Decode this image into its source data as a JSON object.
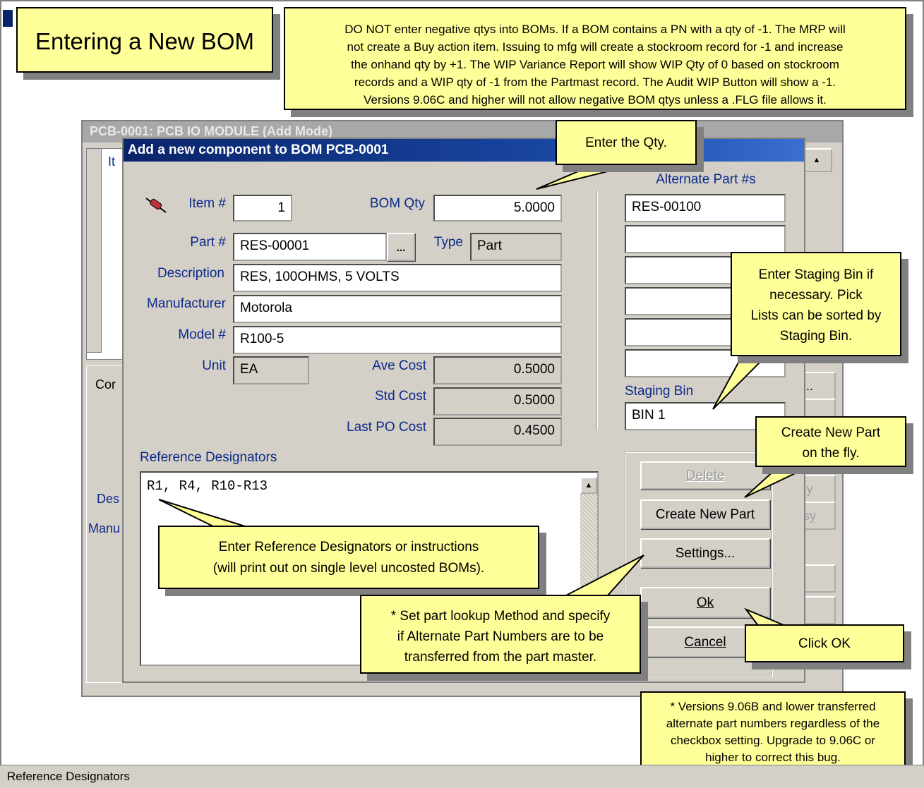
{
  "status_bar": {
    "text": "Reference Designators"
  },
  "background_window": {
    "title": "PCB-0001: PCB IO MODULE     (Add Mode)",
    "grid_col_label": "It",
    "left_labels": [
      "Cor",
      "Des",
      "Manu"
    ],
    "right_buttons": [
      "..",
      "y",
      "sy"
    ]
  },
  "dialog": {
    "title": "Add a new component to BOM PCB-0001",
    "item_label": "Item #",
    "item_value": "1",
    "bomqty_label": "BOM Qty",
    "bomqty_value": "5.0000",
    "part_label": "Part #",
    "part_value": "RES-00001",
    "part_lookup_label": "...",
    "type_label": "Type",
    "type_value": "Part",
    "description_label": "Description",
    "description_value": "RES, 100OHMS, 5 VOLTS",
    "manufacturer_label": "Manufacturer",
    "manufacturer_value": "Motorola",
    "model_label": "Model #",
    "model_value": "R100-5",
    "unit_label": "Unit",
    "unit_value": "EA",
    "avecost_label": "Ave Cost",
    "avecost_value": "0.5000",
    "stdcost_label": "Std Cost",
    "stdcost_value": "0.5000",
    "lastpo_label": "Last PO Cost",
    "lastpo_value": "0.4500",
    "alt_parts_label": "Alternate Part #s",
    "alt_parts": [
      "RES-00100",
      "",
      "",
      "",
      "",
      ""
    ],
    "staging_label": "Staging Bin",
    "staging_value": "BIN 1",
    "ref_label": "Reference Designators",
    "ref_value": "R1, R4, R10-R13",
    "buttons": {
      "delete": "Delete",
      "create": "Create New Part",
      "settings": "Settings...",
      "ok": "Ok",
      "cancel": "Cancel"
    }
  },
  "callouts": {
    "title": "Entering a New BOM",
    "warning": [
      "DO NOT enter negative qtys into BOMs.  If a BOM contains a PN with a qty of -1.  The MRP will",
      "not create a Buy action item.  Issuing to mfg will create a stockroom record for -1 and increase",
      "the onhand qty by +1. The WIP Variance Report will show WIP Qty of 0 based on stockroom",
      "records and a WIP qty of -1 from the Partmast record. The Audit WIP Button will show a -1.",
      "Versions 9.06C and higher will not allow negative BOM qtys unless a .FLG file allows it."
    ],
    "qty": "Enter the Qty.",
    "staging": [
      "Enter Staging Bin if",
      "necessary.  Pick",
      "Lists can be sorted by",
      "Staging Bin."
    ],
    "create_part": [
      "Create New Part",
      "on the fly."
    ],
    "refdes": [
      "Enter Reference Designators or instructions",
      "(will print out on single level uncosted BOMs)."
    ],
    "settings": [
      "* Set part lookup Method and specify",
      "if Alternate Part Numbers are to be",
      "transferred from the part master."
    ],
    "ok": "Click OK",
    "versions": [
      "* Versions 9.06B and lower transferred",
      "alternate part numbers regardless of the",
      "checkbox setting.  Upgrade to 9.06C or",
      "higher to correct this bug."
    ]
  }
}
